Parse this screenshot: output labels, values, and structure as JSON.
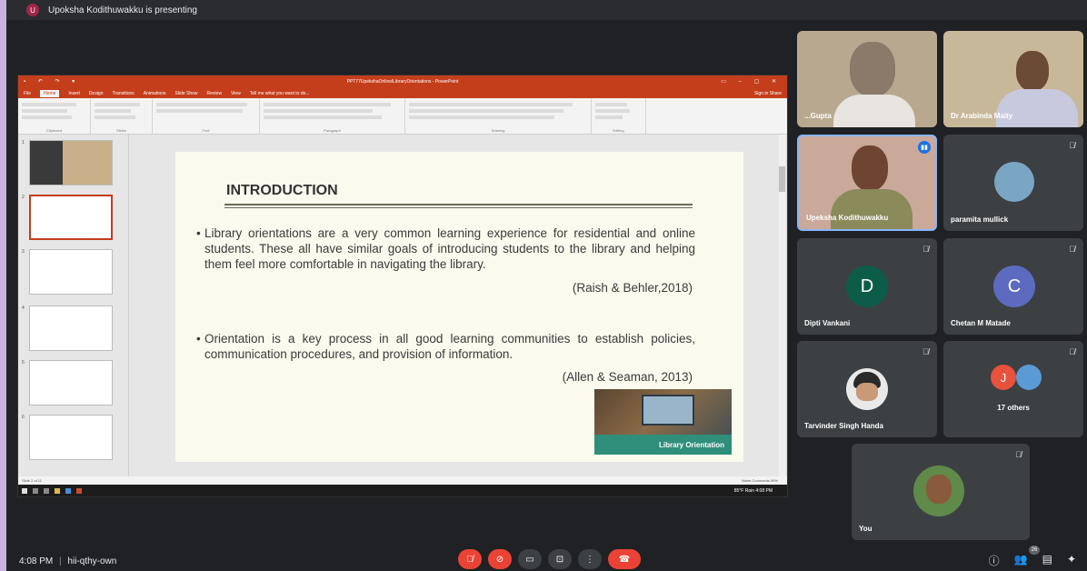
{
  "presenting_bar": {
    "avatar_letter": "U",
    "text": "Upoksha Kodithuwakku is presenting"
  },
  "powerpoint": {
    "title": "PPT77UpekshaOnlinelLibraryOrientations - PowerPoint",
    "tabs": [
      "File",
      "Home",
      "Insert",
      "Design",
      "Transitions",
      "Animations",
      "Slide Show",
      "Review",
      "View",
      "Tell me what you want to do..."
    ],
    "tabs_right": "Sign in   Share",
    "ribbon_groups": [
      "Clipboard",
      "Slides",
      "Font",
      "Paragraph",
      "Drawing",
      "Editing"
    ],
    "status_left": "Slide 2 of 11",
    "status_right": "Notes   Comments       59%"
  },
  "slide": {
    "heading": "INTRODUCTION",
    "bullet1": "Library orientations are a very common learning experience for residential and online students. These all have similar goals of introducing students to the library and helping them feel more comfortable in navigating the library.",
    "cite1": "(Raish & Behler,2018)",
    "bullet2": "Orientation is a key process in all good learning communities to establish policies, communication procedures, and provision of information.",
    "cite2": "(Allen & Seaman, 2013)",
    "image_caption": "Library Orientation"
  },
  "taskbar": {
    "tray": "85°F Rain   4:08 PM"
  },
  "participants": [
    {
      "name": "...Gupta",
      "type": "video"
    },
    {
      "name": "Dr Arabinda Maity",
      "type": "video"
    },
    {
      "name": "Upeksha Kodithuwakku",
      "type": "video",
      "speaking": true
    },
    {
      "name": "paramita mullick",
      "type": "photo"
    },
    {
      "name": "Dipti Vankani",
      "type": "letter",
      "letter": "D",
      "color": "#0d5c4a"
    },
    {
      "name": "Chetan M Matade",
      "type": "letter",
      "letter": "C",
      "color": "#5c6bc0"
    },
    {
      "name": "Tarvinder Singh Handa",
      "type": "photo"
    },
    {
      "name": "17 others",
      "type": "group",
      "letter": "J"
    },
    {
      "name": "You",
      "type": "photo"
    }
  ],
  "bottom": {
    "time": "4:08 PM",
    "meeting_code": "hii-qthy-own",
    "people_count": "26"
  },
  "icons": {
    "mic_off": "mic-off-icon",
    "cam_off": "camera-off-icon",
    "captions": "captions-icon",
    "present": "present-icon",
    "more": "more-icon",
    "end_call": "end-call-icon",
    "info": "info-icon",
    "people": "people-icon",
    "chat": "chat-icon",
    "activities": "activities-icon"
  }
}
